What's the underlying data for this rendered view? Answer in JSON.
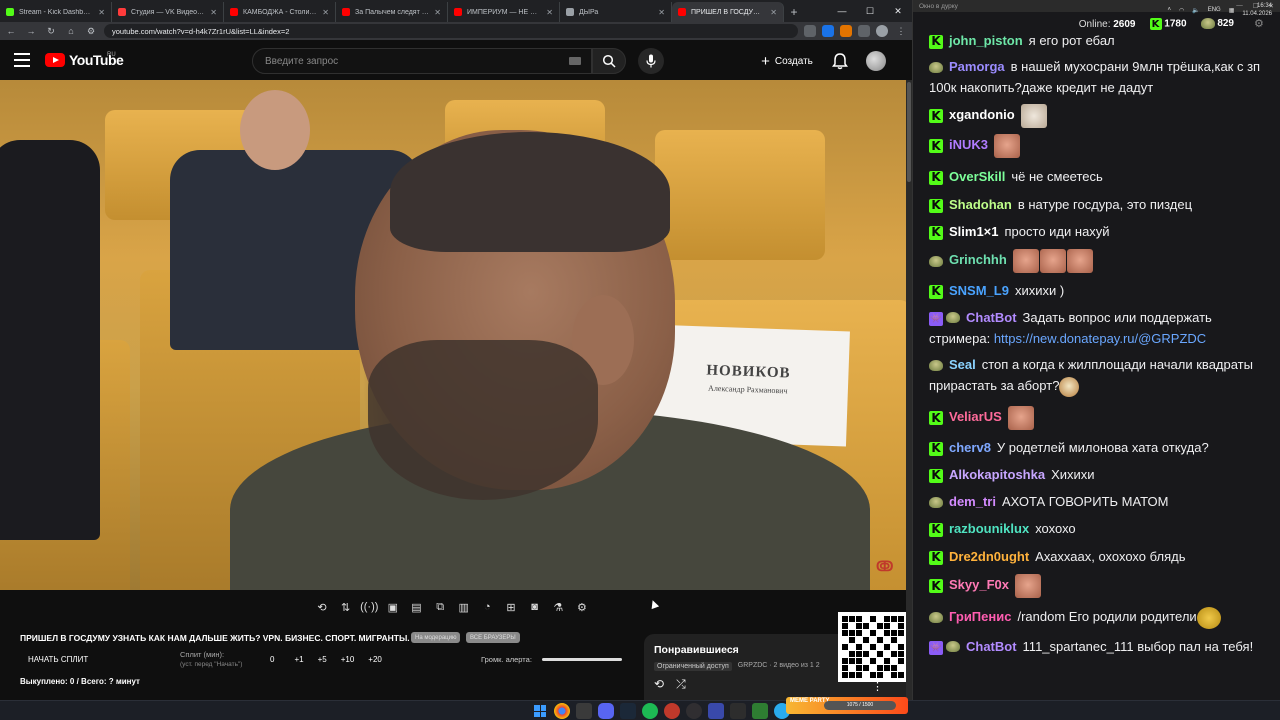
{
  "browser": {
    "tabs": [
      {
        "label": "Stream - Kick Dashboard",
        "color": "#53fc18"
      },
      {
        "label": "Студия — VK Видео Live",
        "color": "#ff3b3b"
      },
      {
        "label": "КАМБОДЖА - Столица Мир",
        "color": "#ff0000"
      },
      {
        "label": "За Палычем следят в реал",
        "color": "#ff0000"
      },
      {
        "label": "ИМПЕРИУМ — НЕ РОССИЯ",
        "color": "#ff0000"
      },
      {
        "label": "ДЫРа",
        "color": "#9aa0a6"
      },
      {
        "label": "ПРИШЕЛ В ГОСДУМУ УЗ",
        "color": "#ff0000",
        "active": true
      }
    ],
    "url": "youtube.com/watch?v=d-h4k7Zr1rU&list=LL&index=2",
    "new_tab": "+"
  },
  "youtube": {
    "logo": "YouTube",
    "region": "RU",
    "search_placeholder": "Введите запрос",
    "create_label": "Создать"
  },
  "video": {
    "namecard_name": "НОВИКОВ",
    "namecard_sub": "Александр Рахманович"
  },
  "panel": {
    "title": "ПРИШЕЛ В ГОСДУМУ УЗНАТЬ КАК НАМ ДАЛЬШЕ ЖИТЬ? VPN. БИЗНЕС. СПОРТ. МИГРАНТЫ.",
    "chip1": "На модерацию",
    "chip2": "ВСЕ БРАУЗЕРЫ",
    "split_button": "НАЧАТЬ СПЛИТ",
    "split_label": "Сплит (мин):",
    "split_hint": "(уст. перед \"Начать\")",
    "split_values": [
      "0",
      "+1",
      "+5",
      "+10",
      "+20"
    ],
    "alert_label": "Громк. алерта:",
    "bought": "Выкуплено: 0 / Всего: ? минут"
  },
  "liked": {
    "title": "Понравившиеся",
    "badge": "Ограниченный доступ",
    "meta": "GRPZDC · 2 видео из 1 2"
  },
  "chat": {
    "window_title": "Окно в дурку",
    "online_label": "Online:",
    "online_value": "2609",
    "kick_count": "1780",
    "other_count": "829",
    "messages": [
      {
        "user": "john_piston",
        "color": "#6ee7a8",
        "badge": "kick",
        "text": "я его рот ебал"
      },
      {
        "user": "Pamorga",
        "color": "#9b8cff",
        "badge": "peepo",
        "text": "в нашей мухосрани 9млн трёшка,как с зп 100к накопить?даже кредит не дадут"
      },
      {
        "user": "xgandonio",
        "color": "#ffffff",
        "badge": "kick",
        "text": ""
      },
      {
        "user": "iNUK3",
        "color": "#b07cff",
        "badge": "kick",
        "text": ""
      },
      {
        "user": "OverSkill",
        "color": "#7dff9a",
        "badge": "kick",
        "text": "чё не смеетесь"
      },
      {
        "user": "Shadohan",
        "color": "#bfff8a",
        "badge": "kick",
        "text": "в натуре госдура, это пиздец"
      },
      {
        "user": "Slim1×1",
        "color": "#ffffff",
        "badge": "kick",
        "text": "просто иди нахуй"
      },
      {
        "user": "Grinchhh",
        "color": "#6ee0b0",
        "badge": "peepo",
        "text": ""
      },
      {
        "user": "SNSM_L9",
        "color": "#4aa3ff",
        "badge": "kick",
        "text": "хихихи )"
      },
      {
        "user": "ChatBot",
        "color": "#b28bff",
        "badge": "bot",
        "text": "Задать вопрос или поддержать стримера:",
        "link": "https://new.donatepay.ru/@GRPZDC"
      },
      {
        "user": "Seal",
        "color": "#8bd3ff",
        "badge": "peepo",
        "text": "стоп а когда к жилплощади начали квадраты прирастать за аборт?"
      },
      {
        "user": "VeliarUS",
        "color": "#ff6b9b",
        "badge": "kick",
        "text": ""
      },
      {
        "user": "cherv8",
        "color": "#7fa8ff",
        "badge": "kick",
        "text": "У родетлей милонова хата откуда?"
      },
      {
        "user": "Alkokapitoshka",
        "color": "#c7a6ff",
        "badge": "kick",
        "text": "Хихихи"
      },
      {
        "user": "dem_tri",
        "color": "#d38bff",
        "badge": "peepo",
        "text": "АХОТА ГОВОРИТЬ МАТОМ"
      },
      {
        "user": "razbouniklux",
        "color": "#4fe3c1",
        "badge": "kick",
        "text": "хохохо"
      },
      {
        "user": "Dre2dn0ught",
        "color": "#ffb23c",
        "badge": "kick",
        "text": "Ахаххаах, охохохо блядь"
      },
      {
        "user": "Skyy_F0x",
        "color": "#ff7ab6",
        "badge": "kick",
        "text": ""
      },
      {
        "user": "ГриПенис",
        "color": "#ff5db1",
        "badge": "peepo",
        "text": "/random Его родили родители"
      },
      {
        "user": "ChatBot",
        "color": "#b28bff",
        "badge": "bot",
        "text": "111_spartanec_111 выбор пал на тебя!"
      }
    ]
  },
  "taskbar": {
    "lang": "ENG",
    "time": "16:34",
    "date": "11.04.2026",
    "meme_party": "MEME PARTY",
    "meme_progress": "1075 / 1500"
  }
}
